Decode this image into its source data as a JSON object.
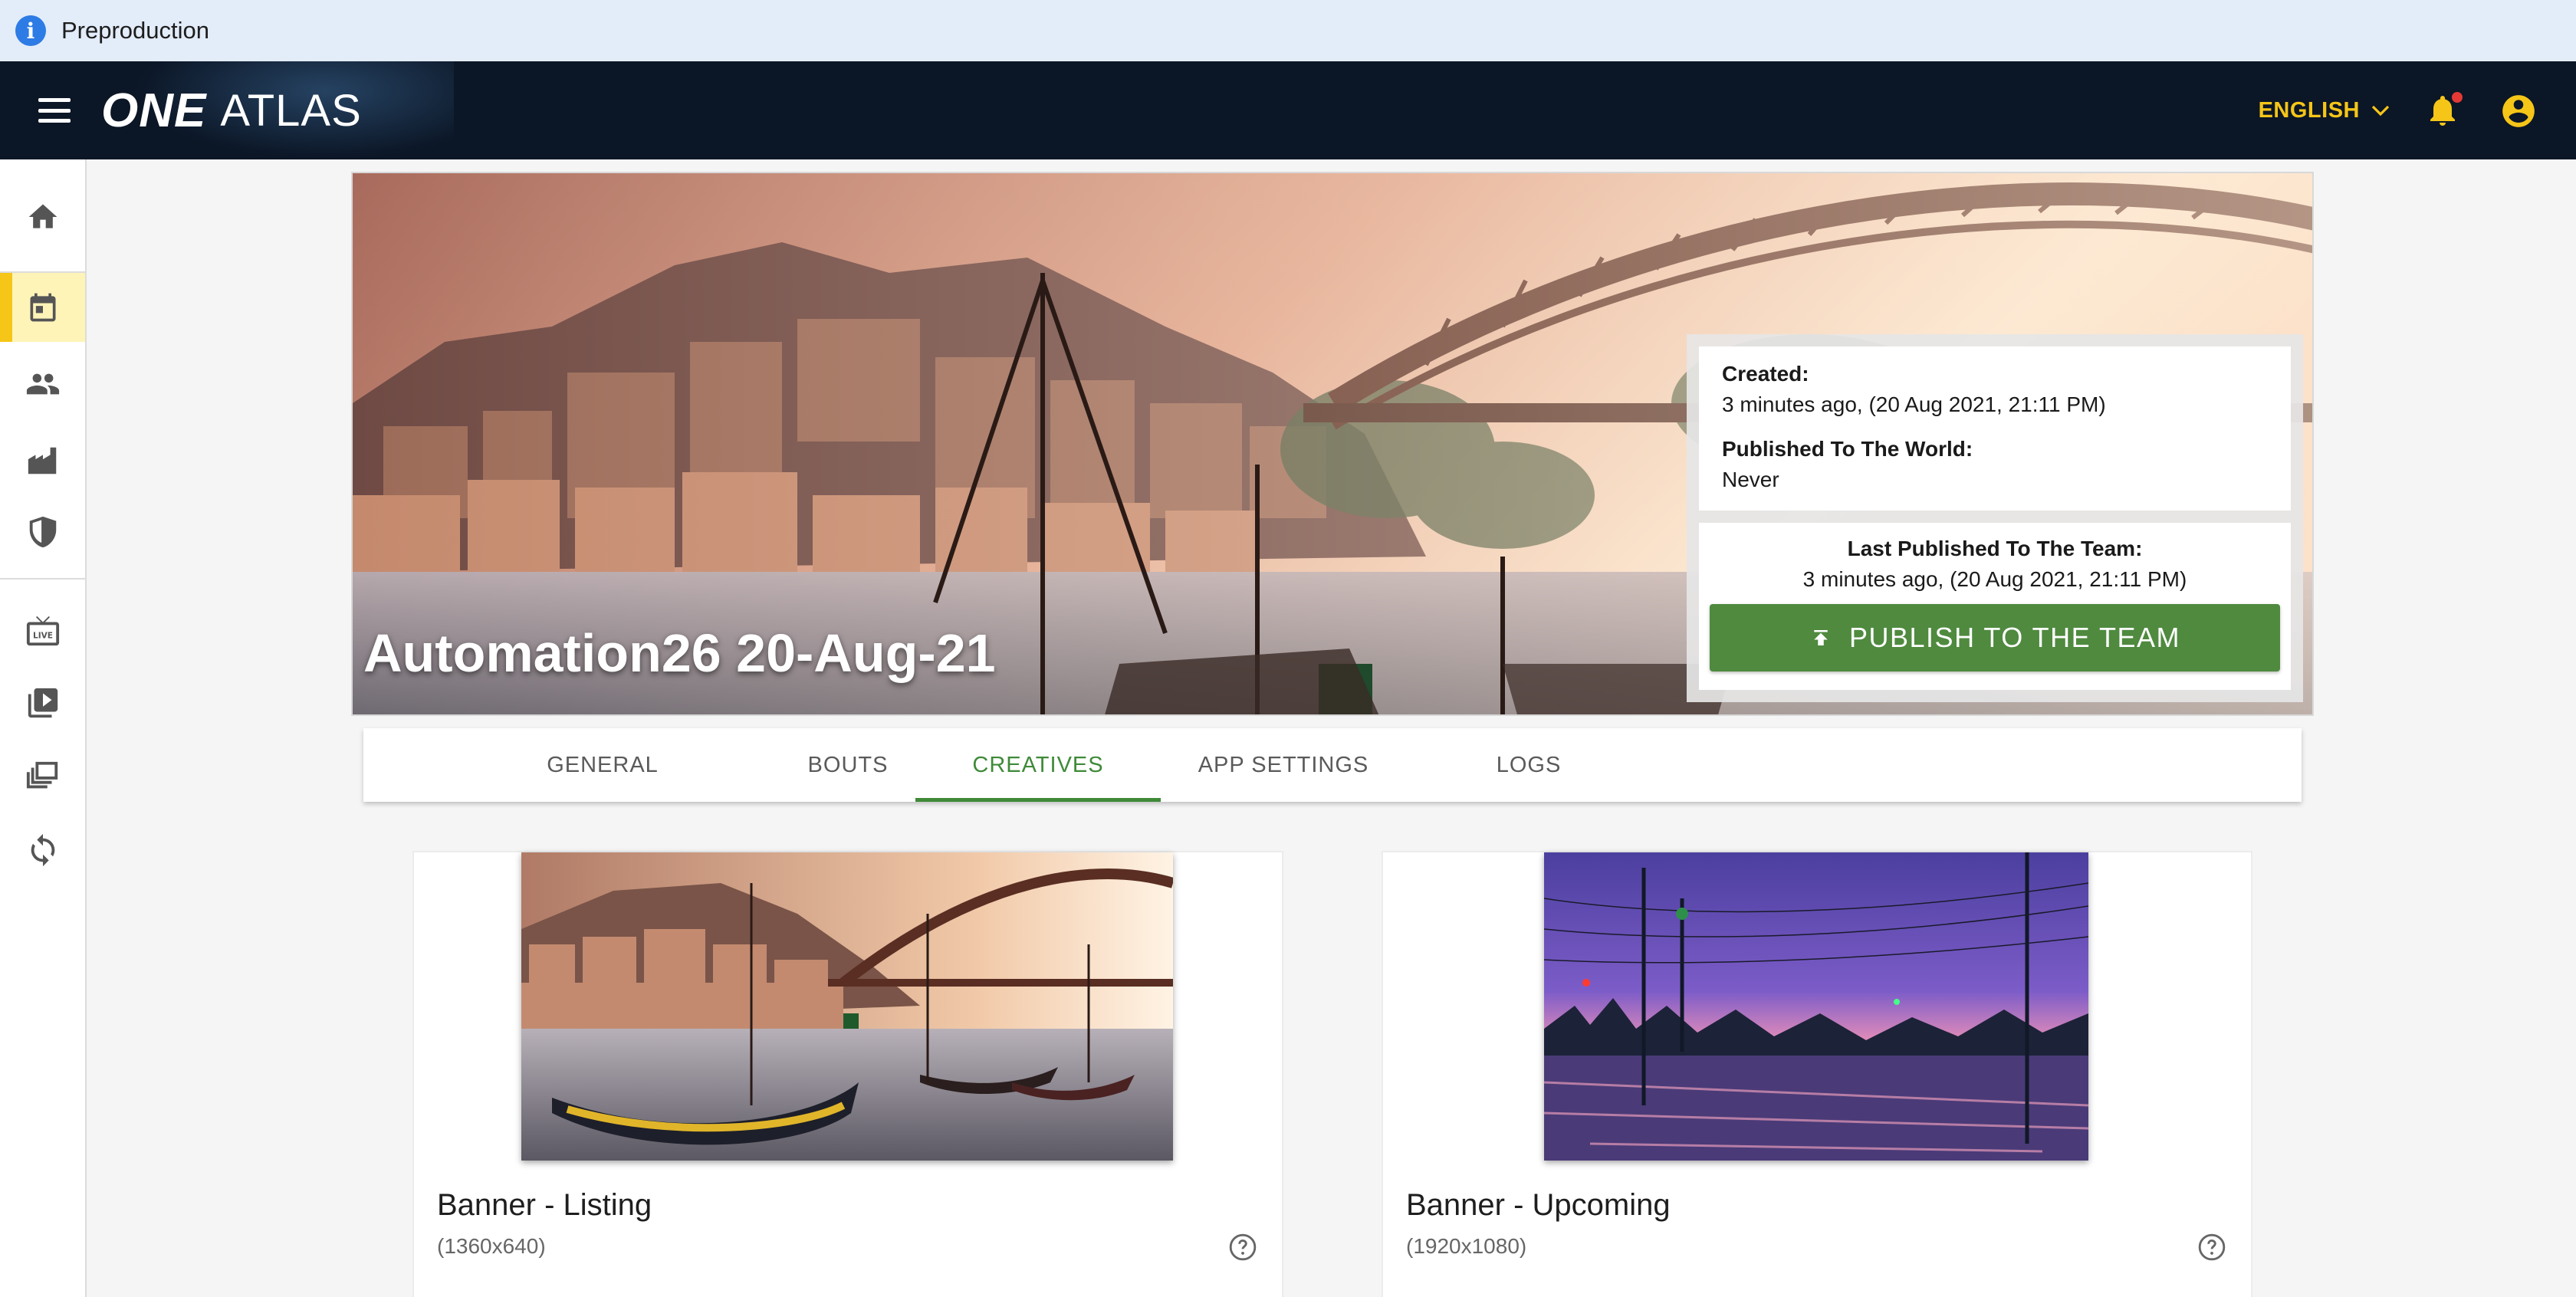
{
  "env_banner": {
    "text": "Preproduction",
    "icon": "info-icon"
  },
  "topbar": {
    "logo_one": "ONE",
    "logo_atlas": "ATLAS",
    "language": "ENGLISH",
    "accent_color": "#f5c518",
    "has_notification": true
  },
  "sidebar": {
    "items": [
      {
        "icon": "home-icon",
        "active": false
      },
      {
        "icon": "calendar-icon",
        "active": true
      },
      {
        "icon": "people-icon",
        "active": false
      },
      {
        "icon": "building-icon",
        "active": false
      },
      {
        "icon": "shield-icon",
        "active": false
      },
      {
        "icon": "live-tv-icon",
        "active": false
      },
      {
        "icon": "video-library-icon",
        "active": false
      },
      {
        "icon": "collections-icon",
        "active": false
      },
      {
        "icon": "sync-icon",
        "active": false
      }
    ]
  },
  "event": {
    "title": "Automation26 20-Aug-21",
    "created_label": "Created:",
    "created_value": "3 minutes ago, (20 Aug 2021, 21:11 PM)",
    "published_world_label": "Published To The World:",
    "published_world_value": "Never",
    "last_published_team_label": "Last Published To The Team:",
    "last_published_team_value": "3 minutes ago, (20 Aug 2021, 21:11 PM)",
    "publish_button": "PUBLISH TO THE TEAM",
    "publish_color": "#4f8a3f"
  },
  "tabs": [
    {
      "label": "GENERAL",
      "active": false
    },
    {
      "label": "BOUTS",
      "active": false
    },
    {
      "label": "CREATIVES",
      "active": true
    },
    {
      "label": "APP SETTINGS",
      "active": false
    },
    {
      "label": "LOGS",
      "active": false
    }
  ],
  "creatives": [
    {
      "title": "Banner - Listing",
      "size": "(1360x640)",
      "image": "porto-riverside-boats"
    },
    {
      "title": "Banner - Upcoming",
      "size": "(1920x1080)",
      "image": "purple-dusk-street"
    }
  ]
}
